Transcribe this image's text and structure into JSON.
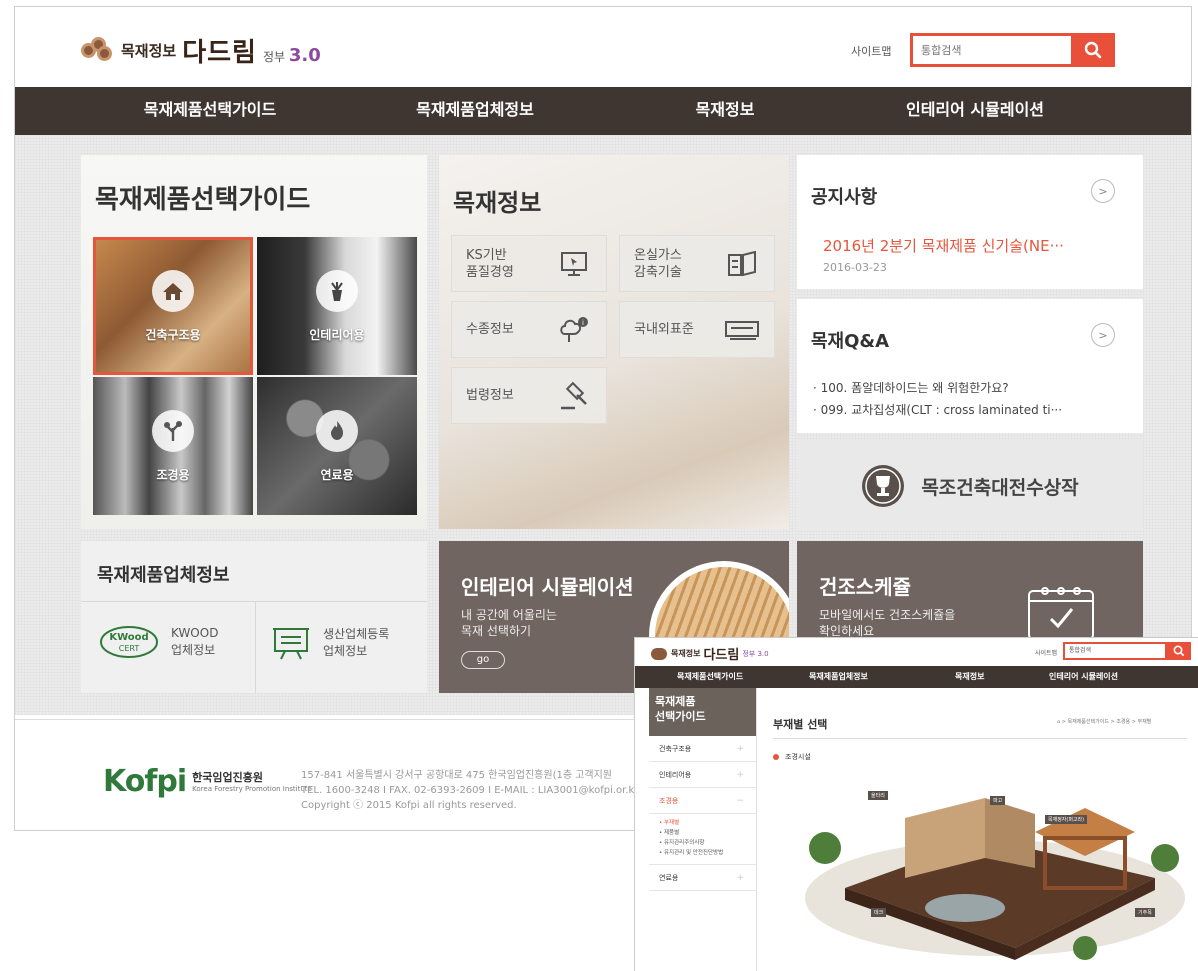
{
  "header": {
    "logo_name": "목재정보",
    "logo_brand": "다드림",
    "logo_version_label": "정부",
    "logo_version": "3.0",
    "sitemap": "사이트맵",
    "search_placeholder": "통합검색"
  },
  "gnb": [
    "목재제품선택가이드",
    "목재제품업체정보",
    "목재정보",
    "인테리어 시뮬레이션"
  ],
  "guide": {
    "title": "목재제품선택가이드",
    "tiles": [
      "건축구조용",
      "인테리어용",
      "조경용",
      "연료용"
    ]
  },
  "info": {
    "title": "목재정보",
    "buttons": [
      {
        "line1": "KS기반",
        "line2": "품질경영"
      },
      {
        "line1": "온실가스",
        "line2": "감축기술"
      },
      {
        "line1": "수종정보",
        "line2": ""
      },
      {
        "line1": "국내외표준",
        "line2": ""
      },
      {
        "line1": "법령정보",
        "line2": ""
      }
    ]
  },
  "notice": {
    "title": "공지사항",
    "item_title": "2016년 2분기 목재제품 신기술(NE···",
    "item_date": "2016-03-23"
  },
  "qna": {
    "title": "목재Q&A",
    "items": [
      "· 100. 폼알데하이드는 왜 위험한가요?",
      "· 099. 교차집성재(CLT : cross laminated ti···"
    ]
  },
  "award": {
    "label": "목조건축대전수상작"
  },
  "company": {
    "title": "목재제품업체정보",
    "kwood_line1": "KWOOD",
    "kwood_line2": "업체정보",
    "kwood_logo_top": "KWood",
    "kwood_logo_bottom": "CERT",
    "reg_line1": "생산업체등록",
    "reg_line2": "업체정보"
  },
  "simulation": {
    "title": "인테리어 시뮬레이션",
    "sub1": "내 공간에 어울리는",
    "sub2": "목재 선택하기",
    "go": "go"
  },
  "schedule": {
    "title": "건조스케쥴",
    "sub1": "모바일에서도 건조스케쥴을",
    "sub2": "확인하세요"
  },
  "footer": {
    "kofpi": "Kofpi",
    "org_name": "한국임업진흥원",
    "org_eng": "Korea Forestry Promotion Institute",
    "line1": "157-841 서울특별시 강서구 공항대로 475 한국임업진흥원(1층 고객지원",
    "line2": "TEL. 1600-3248 I FAX. 02-6393-2609 I E-MAIL : LIA3001@kofpi.or.kr I 사업",
    "line3": "Copyright ⓒ 2015 Kofpi all rights reserved."
  },
  "overlay": {
    "logo_name": "목재정보",
    "logo_brand": "다드림",
    "logo_version": "정부 3.0",
    "sitemap": "사이트맵",
    "search": "통합검색",
    "gnb": [
      "목재제품선택가이드",
      "목재제품업체정보",
      "목재정보",
      "인테리어 시뮬레이션"
    ],
    "side_head_1": "목재제품",
    "side_head_2": "선택가이드",
    "side_items": [
      "건축구조용",
      "인테리어용",
      "조경용"
    ],
    "side_sub": [
      "• 부재별",
      "• 제품별",
      "• 유지관리주의사항",
      "• 유지관리 및 안전진단방법"
    ],
    "side_last": "연료용",
    "main_title": "부재별 선택",
    "breadcrumb": "⌂ > 목재제품선택가이드 > 조경용 > 부재별",
    "category": "조경시설",
    "tags": [
      "울타리",
      "파고",
      "목재정자(퍼고라)",
      "데크",
      "기주목"
    ]
  }
}
